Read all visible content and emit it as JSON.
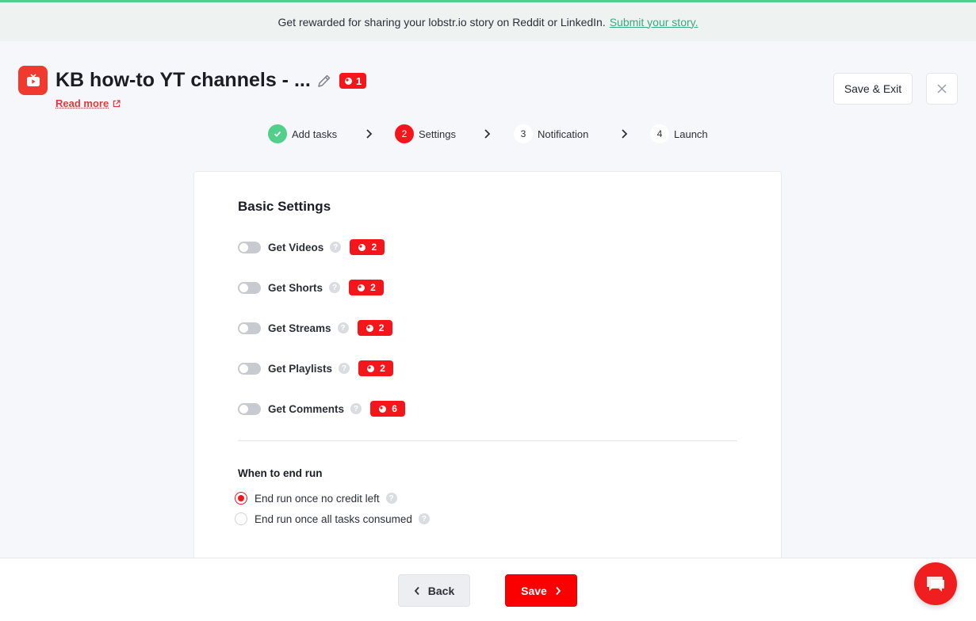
{
  "banner": {
    "text": "Get rewarded for sharing your lobstr.io story on Reddit or LinkedIn.",
    "link": "Submit your story."
  },
  "header": {
    "title": "KB how-to YT channels - ...",
    "credit_count": "1",
    "read_more": "Read more",
    "save_exit": "Save & Exit"
  },
  "steps": [
    {
      "number": "",
      "label": "Add tasks",
      "state": "done"
    },
    {
      "number": "2",
      "label": "Settings",
      "state": "active"
    },
    {
      "number": "3",
      "label": "Notification",
      "state": "todo"
    },
    {
      "number": "4",
      "label": "Launch",
      "state": "todo"
    }
  ],
  "settings": {
    "title": "Basic Settings",
    "items": [
      {
        "label": "Get Videos",
        "credits": "2",
        "enabled": false
      },
      {
        "label": "Get Shorts",
        "credits": "2",
        "enabled": false
      },
      {
        "label": "Get Streams",
        "credits": "2",
        "enabled": false
      },
      {
        "label": "Get Playlists",
        "credits": "2",
        "enabled": false
      },
      {
        "label": "Get Comments",
        "credits": "6",
        "enabled": false
      }
    ],
    "help_glyph": "?"
  },
  "end_run": {
    "title": "When to end run",
    "options": [
      {
        "label": "End run once no credit left",
        "selected": true
      },
      {
        "label": "End run once all tasks consumed",
        "selected": false
      }
    ]
  },
  "footer": {
    "back": "Back",
    "save": "Save"
  },
  "colors": {
    "brand_red": "#f5161c",
    "success_green": "#52cf8a",
    "link_green": "#3aa981"
  }
}
